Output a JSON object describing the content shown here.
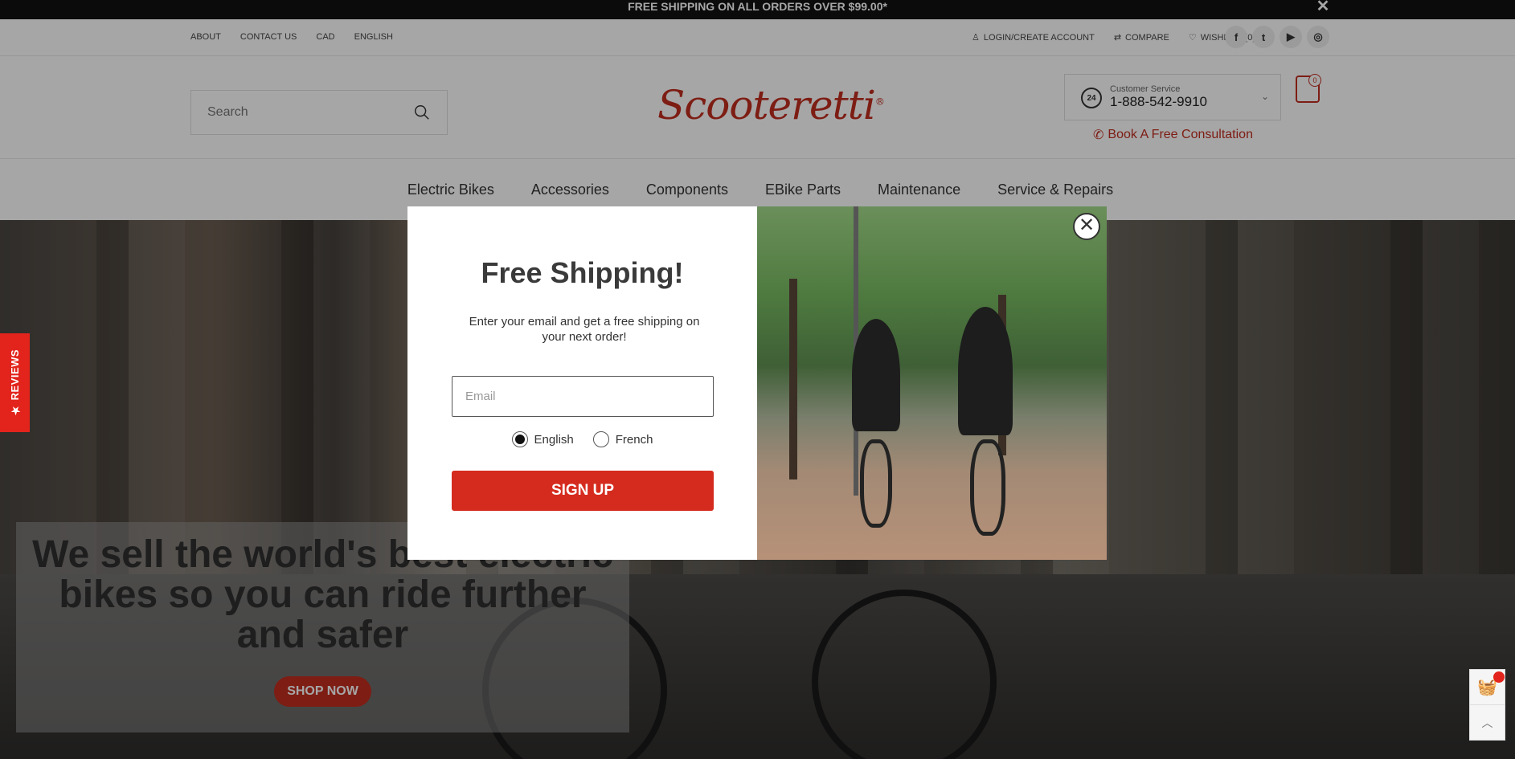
{
  "announcement": {
    "text": "FREE SHIPPING ON ALL ORDERS OVER $99.00*",
    "close": "✕"
  },
  "topbar": {
    "left_links": [
      "ABOUT",
      "CONTACT US",
      "CAD",
      "ENGLISH"
    ],
    "login": "LOGIN/CREATE ACCOUNT",
    "compare": "COMPARE",
    "wishlist": "WISHLIST (0)",
    "socials": [
      "f",
      "t",
      "▶",
      "◎"
    ]
  },
  "header": {
    "search_placeholder": "Search",
    "logo": "Scooteretti",
    "service_badge": "24",
    "service_label": "Customer Service",
    "service_phone": "1-888-542-9910",
    "consultation": "Book A Free Consultation",
    "cart_count": "0"
  },
  "nav": [
    "Electric Bikes",
    "Accessories",
    "Components",
    "EBike Parts",
    "Maintenance",
    "Service & Repairs"
  ],
  "hero": {
    "title": "We sell the world's best electric bikes so you can ride further and safer",
    "cta": "SHOP NOW"
  },
  "reviews_tab": "★ REVIEWS",
  "modal": {
    "title": "Free Shipping!",
    "description": "Enter your email and get a free shipping on your next order!",
    "email_placeholder": "Email",
    "languages": [
      "English",
      "French"
    ],
    "selected_language": "English",
    "signup": "SIGN UP",
    "close": "✕"
  },
  "colors": {
    "brand": "#c12d1f",
    "signup": "#d52b1e",
    "reviews": "#e2241c"
  }
}
